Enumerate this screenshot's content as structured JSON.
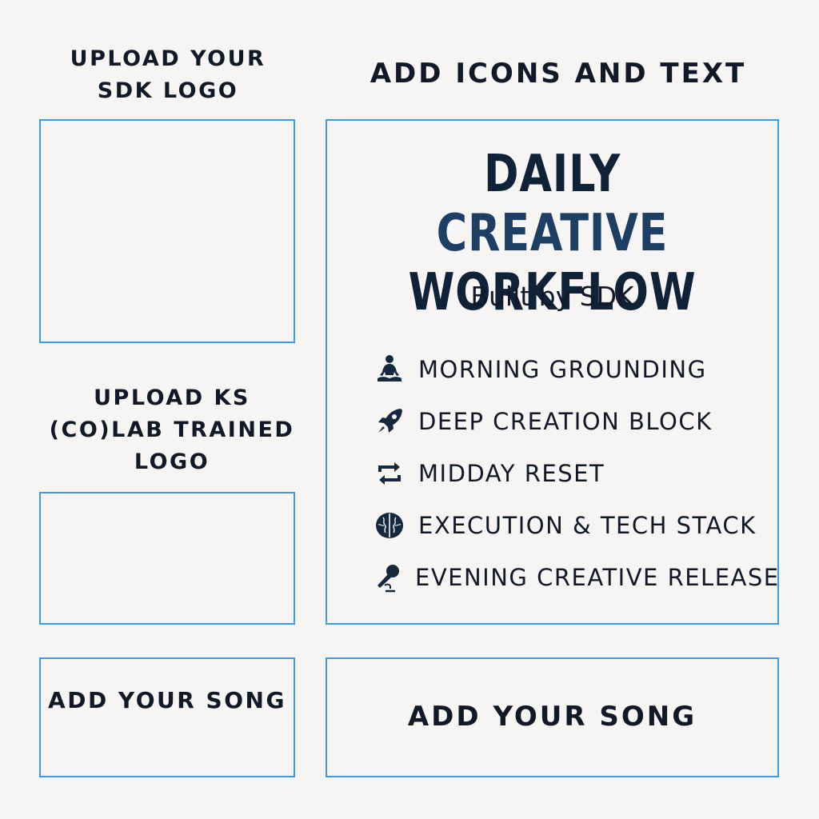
{
  "labels": {
    "upload_sdk_logo": "UPLOAD YOUR SDK LOGO",
    "upload_ks_logo": "UPLOAD KS (CO)LAB TRAINED LOGO",
    "add_icons_text": "ADD ICONS AND TEXT"
  },
  "main": {
    "title_word1": "DAILY ",
    "title_word2": "CREATIVE",
    "title_line2": "WORKFLOW",
    "subtitle": "Built by SDK",
    "items": [
      {
        "icon": "meditation-icon",
        "label": "MORNING GROUNDING"
      },
      {
        "icon": "rocket-icon",
        "label": "DEEP CREATION BLOCK"
      },
      {
        "icon": "repeat-icon",
        "label": "MIDDAY RESET"
      },
      {
        "icon": "brain-icon",
        "label": "EXECUTION & TECH STACK"
      },
      {
        "icon": "microphone-icon",
        "label": "EVENING CREATIVE RELEASE"
      }
    ]
  },
  "song": {
    "small": "ADD YOUR SONG",
    "large": "ADD YOUR SONG"
  },
  "colors": {
    "border": "#3b9be6",
    "title": "#0f2238",
    "background": "#f6f5f4"
  }
}
